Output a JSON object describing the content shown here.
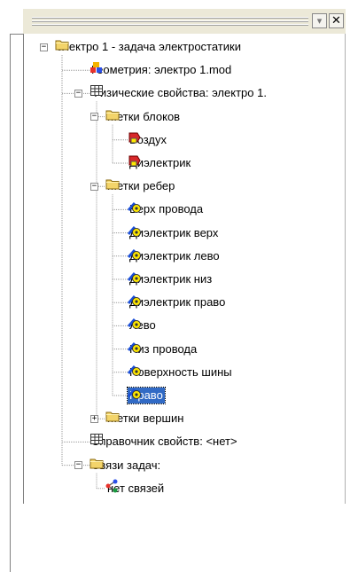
{
  "titlebar": {
    "minimize_glyph": "▾",
    "close_glyph": "✕"
  },
  "tree": {
    "nodes": [
      {
        "label": "электро 1 - задача электростатики",
        "icon": "folder-icon",
        "expanded": true
      },
      {
        "label": "Геометрия: электро 1.mod",
        "icon": "geometry-model-icon"
      },
      {
        "label": "Физические свойства: электро 1.",
        "icon": "table-grid-icon",
        "expanded": true
      },
      {
        "label": "Метки блоков",
        "icon": "folder-icon",
        "expanded": true
      },
      {
        "label": "Воздух",
        "icon": "block-label-icon"
      },
      {
        "label": "Диэлектрик",
        "icon": "block-label-icon"
      },
      {
        "label": "Метки ребер",
        "icon": "folder-icon",
        "expanded": true
      },
      {
        "label": "Верх провода",
        "icon": "edge-label-icon"
      },
      {
        "label": "Диэлектрик верх",
        "icon": "edge-label-icon"
      },
      {
        "label": "Диэлектрик лево",
        "icon": "edge-label-icon"
      },
      {
        "label": "Диэлектрик низ",
        "icon": "edge-label-icon"
      },
      {
        "label": "Диэлектрик право",
        "icon": "edge-label-icon"
      },
      {
        "label": "Лево",
        "icon": "edge-label-icon"
      },
      {
        "label": "Низ провода",
        "icon": "edge-label-icon"
      },
      {
        "label": "Поверхность шины",
        "icon": "edge-label-icon"
      },
      {
        "label": "Право",
        "icon": "edge-label-icon",
        "selected": true
      },
      {
        "label": "Метки вершин",
        "icon": "folder-icon",
        "expanded": false
      },
      {
        "label": "Справочник свойств: <нет>",
        "icon": "table-grid-icon"
      },
      {
        "label": "Связи задач:",
        "icon": "folder-icon",
        "expanded": true
      },
      {
        "label": "нет связей",
        "icon": "links-icon"
      }
    ]
  },
  "colors": {
    "selection": "#316ac5",
    "folder": "#f3d46a",
    "block_label": "#d8282a",
    "edge_label": "#1a4fd8",
    "label_tag": "#ffe800"
  }
}
